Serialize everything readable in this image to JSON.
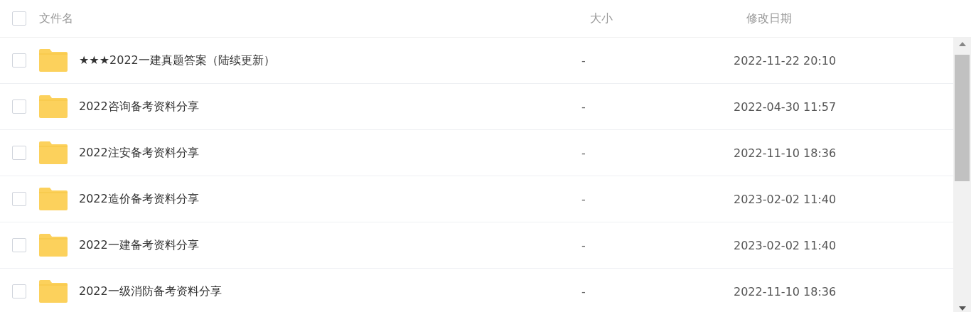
{
  "header": {
    "checked": false,
    "columns": [
      "文件名",
      "大小",
      "修改日期"
    ]
  },
  "rows": [
    {
      "name": "★★★2022一建真题答案（陆续更新）",
      "size": "-",
      "modified": "2022-11-22 20:10",
      "checked": false
    },
    {
      "name": "2022咨询备考资料分享",
      "size": "-",
      "modified": "2022-04-30 11:57",
      "checked": false
    },
    {
      "name": "2022注安备考资料分享",
      "size": "-",
      "modified": "2022-11-10 18:36",
      "checked": false
    },
    {
      "name": "2022造价备考资料分享",
      "size": "-",
      "modified": "2023-02-02 11:40",
      "checked": false
    },
    {
      "name": "2022一建备考资料分享",
      "size": "-",
      "modified": "2023-02-02 11:40",
      "checked": false
    },
    {
      "name": "2022一级消防备考资料分享",
      "size": "-",
      "modified": "2022-11-10 18:36",
      "checked": false
    }
  ]
}
